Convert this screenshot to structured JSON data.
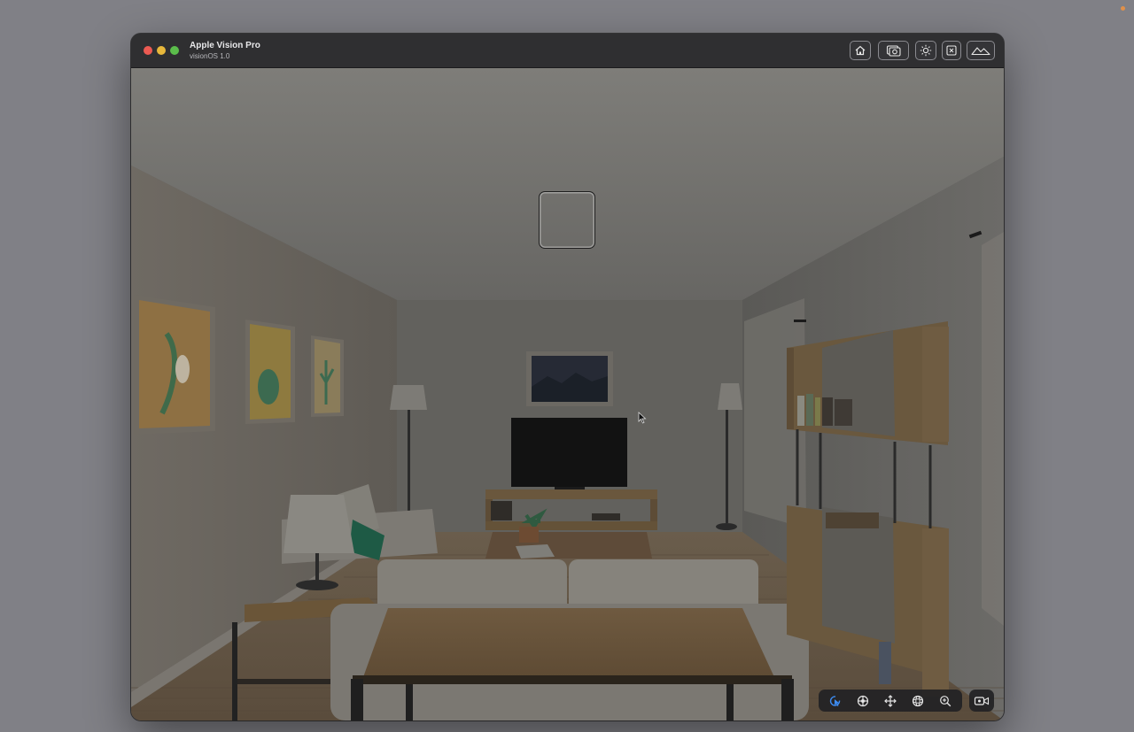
{
  "window": {
    "title": "Apple Vision Pro",
    "subtitle": "visionOS 1.0"
  },
  "toolbar": {
    "buttons": [
      {
        "name": "home",
        "icon": "home-icon"
      },
      {
        "name": "screenshot",
        "icon": "camera-icon"
      },
      {
        "name": "environment-lighting",
        "icon": "sun-icon"
      },
      {
        "name": "device-close",
        "icon": "close-square-icon"
      },
      {
        "name": "scene-environment",
        "icon": "mountains-icon"
      }
    ]
  },
  "bottom_controls": {
    "buttons": [
      {
        "name": "interact",
        "icon": "pointer-icon",
        "active": true
      },
      {
        "name": "look",
        "icon": "look-icon"
      },
      {
        "name": "pan",
        "icon": "move-arrows-icon"
      },
      {
        "name": "orbit",
        "icon": "orbit-icon"
      },
      {
        "name": "zoom",
        "icon": "zoom-icon"
      }
    ],
    "record": {
      "icon": "record-video-icon"
    }
  },
  "colors": {
    "accent": "#3d8df5",
    "titlebar": "#2f2f31",
    "close": "#ec5a52",
    "minimize": "#e7b73b",
    "maximize": "#5bbd4b"
  }
}
